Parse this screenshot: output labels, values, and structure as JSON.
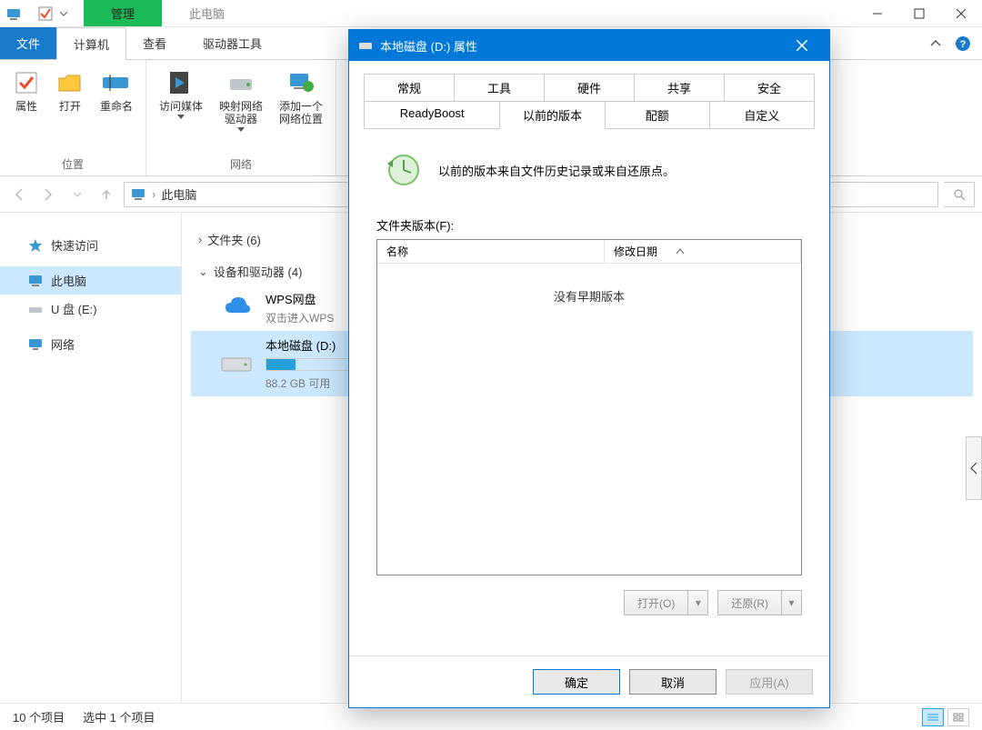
{
  "titlebar": {
    "context_label": "管理",
    "window_title": "此电脑"
  },
  "ribbon": {
    "tabs": {
      "file": "文件",
      "computer": "计算机",
      "view": "查看",
      "drive_tools": "驱动器工具"
    },
    "location_group": {
      "properties": "属性",
      "open": "打开",
      "rename": "重命名",
      "label": "位置"
    },
    "network_group": {
      "media": "访问媒体",
      "map": "映射网络\n驱动器",
      "add_loc": "添加一个\n网络位置",
      "label": "网络"
    }
  },
  "addr": {
    "location": "此电脑"
  },
  "navpane": {
    "quick": "快速访问",
    "this_pc": "此电脑",
    "usb": "U 盘 (E:)",
    "network": "网络"
  },
  "content": {
    "folders_header": "文件夹 (6)",
    "devices_header": "设备和驱动器 (4)",
    "wps": {
      "name": "WPS网盘",
      "sub": "双击进入WPS"
    },
    "drive_d": {
      "name": "本地磁盘 (D:)",
      "free": "88.2 GB 可用"
    }
  },
  "statusbar": {
    "count": "10 个项目",
    "selected": "选中 1 个项目"
  },
  "dialog": {
    "title": "本地磁盘 (D:) 属性",
    "tabs": {
      "general": "常规",
      "tools": "工具",
      "hardware": "硬件",
      "sharing": "共享",
      "security": "安全",
      "readyboost": "ReadyBoost",
      "previous": "以前的版本",
      "quota": "配额",
      "custom": "自定义"
    },
    "info_text": "以前的版本来自文件历史记录或来自还原点。",
    "list_label": "文件夹版本(F):",
    "col_name": "名称",
    "col_date": "修改日期",
    "empty_text": "没有早期版本",
    "open_btn": "打开(O)",
    "restore_btn": "还原(R)",
    "ok": "确定",
    "cancel": "取消",
    "apply": "应用(A)"
  }
}
